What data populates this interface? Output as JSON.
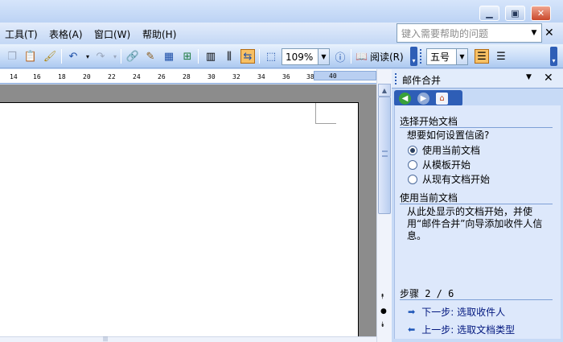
{
  "menubar": {
    "items": [
      {
        "label": "工具(T)"
      },
      {
        "label": "表格(A)"
      },
      {
        "label": "窗口(W)"
      },
      {
        "label": "帮助(H)"
      }
    ],
    "help_search_placeholder": "键入需要帮助的问题"
  },
  "toolbar": {
    "zoom": "109%",
    "read_label": "阅读(R)",
    "font_size": "五号"
  },
  "ruler": {
    "ticks": [
      "14",
      "16",
      "18",
      "20",
      "22",
      "24",
      "26",
      "28",
      "30",
      "32",
      "34",
      "36",
      "38",
      "40"
    ]
  },
  "taskpane": {
    "title": "邮件合并",
    "section1_title": "选择开始文档",
    "question": "想要如何设置信函?",
    "options": [
      {
        "label": "使用当前文档",
        "selected": true
      },
      {
        "label": "从模板开始",
        "selected": false
      },
      {
        "label": "从现有文档开始",
        "selected": false
      }
    ],
    "section2_title": "使用当前文档",
    "description": "从此处显示的文档开始，并使用“邮件合并”向导添加收件人信息。",
    "step_label": "步骤 2 / 6",
    "next_link": "下一步: 选取收件人",
    "prev_link": "上一步: 选取文档类型"
  },
  "colors": {
    "accent": "#2e5eb6",
    "link": "#00167e",
    "pane_bg": "#dde8fb"
  }
}
